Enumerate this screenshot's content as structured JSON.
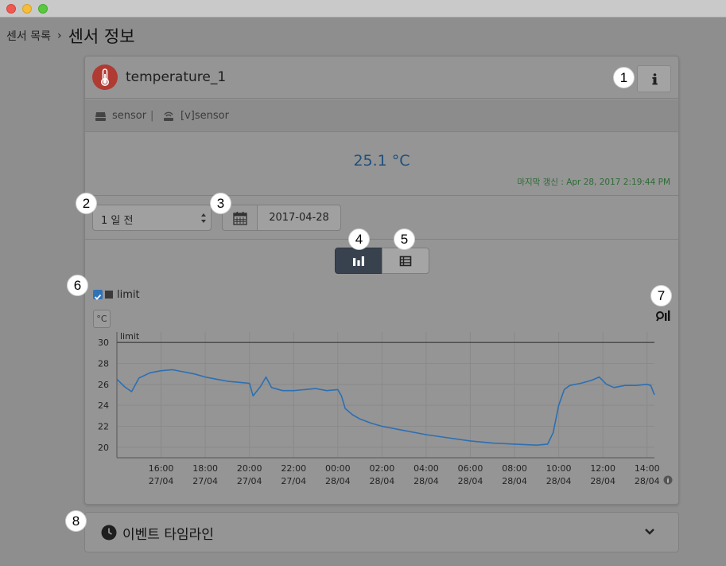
{
  "window": {
    "breadcrumb_parent": "센서 목록",
    "breadcrumb_separator": "›",
    "title": "센서 정보"
  },
  "sensor": {
    "name": "temperature_1",
    "icon": "thermometer-icon",
    "info_icon": "info-icon"
  },
  "meta": {
    "device": "sensor",
    "device_icon": "device-icon",
    "divider": "|",
    "virtual": "[v]sensor",
    "virtual_icon": "signal-icon"
  },
  "reading": {
    "value": "25.1 °C",
    "last_update": "마지막 갱신 : Apr 28, 2017 2:19:44 PM"
  },
  "controls": {
    "period": "1 일 전",
    "date": "2017-04-28",
    "calendar_icon": "calendar-icon",
    "chart_view_icon": "bar-chart-icon",
    "table_view_icon": "table-icon"
  },
  "legend": {
    "label": "limit",
    "checked": true
  },
  "unit": "°C",
  "zoom_icon": "zoom-icon",
  "annotations": [
    "1",
    "2",
    "3",
    "4",
    "5",
    "6",
    "7",
    "8"
  ],
  "timeline": {
    "label": "이벤트 타임라인",
    "icon": "clock-icon",
    "toggle_icon": "chevron-down-icon"
  },
  "colors": {
    "line": "#2d6fb3",
    "limit": "#3a3a3a",
    "value_text": "#1f4f7d",
    "updated_text": "#2d6b35",
    "sensor_icon_bg": "#b03b33"
  },
  "chart_data": {
    "type": "line",
    "ylabel": "°C",
    "ylim": [
      19,
      31
    ],
    "yticks": [
      20,
      22,
      24,
      26,
      28,
      30
    ],
    "xlim": [
      "2017-04-27 14:00",
      "2017-04-28 14:20"
    ],
    "xticks": [
      {
        "time": "2017-04-27 16:00",
        "line1": "16:00",
        "line2": "27/04"
      },
      {
        "time": "2017-04-27 18:00",
        "line1": "18:00",
        "line2": "27/04"
      },
      {
        "time": "2017-04-27 20:00",
        "line1": "20:00",
        "line2": "27/04"
      },
      {
        "time": "2017-04-27 22:00",
        "line1": "22:00",
        "line2": "27/04"
      },
      {
        "time": "2017-04-28 00:00",
        "line1": "00:00",
        "line2": "28/04"
      },
      {
        "time": "2017-04-28 02:00",
        "line1": "02:00",
        "line2": "28/04"
      },
      {
        "time": "2017-04-28 04:00",
        "line1": "04:00",
        "line2": "28/04"
      },
      {
        "time": "2017-04-28 06:00",
        "line1": "06:00",
        "line2": "28/04"
      },
      {
        "time": "2017-04-28 08:00",
        "line1": "08:00",
        "line2": "28/04"
      },
      {
        "time": "2017-04-28 10:00",
        "line1": "10:00",
        "line2": "28/04"
      },
      {
        "time": "2017-04-28 12:00",
        "line1": "12:00",
        "line2": "28/04"
      },
      {
        "time": "2017-04-28 14:00",
        "line1": "14:00",
        "line2": "28/04"
      }
    ],
    "limit": {
      "name": "limit",
      "value": 30
    },
    "series": [
      {
        "name": "limit",
        "points": [
          [
            "2017-04-27 14:00",
            26.5
          ],
          [
            "2017-04-27 14:20",
            25.8
          ],
          [
            "2017-04-27 14:40",
            25.3
          ],
          [
            "2017-04-27 15:00",
            26.6
          ],
          [
            "2017-04-27 15:30",
            27.1
          ],
          [
            "2017-04-27 16:00",
            27.3
          ],
          [
            "2017-04-27 16:30",
            27.4
          ],
          [
            "2017-04-27 17:00",
            27.2
          ],
          [
            "2017-04-27 17:30",
            27.0
          ],
          [
            "2017-04-27 18:00",
            26.7
          ],
          [
            "2017-04-27 18:30",
            26.5
          ],
          [
            "2017-04-27 19:00",
            26.3
          ],
          [
            "2017-04-27 19:30",
            26.2
          ],
          [
            "2017-04-27 20:00",
            26.1
          ],
          [
            "2017-04-27 20:10",
            24.9
          ],
          [
            "2017-04-27 20:30",
            25.8
          ],
          [
            "2017-04-27 20:45",
            26.7
          ],
          [
            "2017-04-27 21:00",
            25.7
          ],
          [
            "2017-04-27 21:30",
            25.4
          ],
          [
            "2017-04-27 22:00",
            25.4
          ],
          [
            "2017-04-27 22:30",
            25.5
          ],
          [
            "2017-04-27 23:00",
            25.6
          ],
          [
            "2017-04-27 23:30",
            25.4
          ],
          [
            "2017-04-28 00:00",
            25.5
          ],
          [
            "2017-04-28 00:10",
            24.9
          ],
          [
            "2017-04-28 00:20",
            23.7
          ],
          [
            "2017-04-28 00:40",
            23.1
          ],
          [
            "2017-04-28 01:00",
            22.7
          ],
          [
            "2017-04-28 01:30",
            22.3
          ],
          [
            "2017-04-28 02:00",
            22.0
          ],
          [
            "2017-04-28 03:00",
            21.6
          ],
          [
            "2017-04-28 04:00",
            21.2
          ],
          [
            "2017-04-28 05:00",
            20.9
          ],
          [
            "2017-04-28 06:00",
            20.6
          ],
          [
            "2017-04-28 07:00",
            20.4
          ],
          [
            "2017-04-28 08:00",
            20.3
          ],
          [
            "2017-04-28 09:00",
            20.2
          ],
          [
            "2017-04-28 09:30",
            20.3
          ],
          [
            "2017-04-28 09:45",
            21.4
          ],
          [
            "2017-04-28 10:00",
            24.0
          ],
          [
            "2017-04-28 10:15",
            25.5
          ],
          [
            "2017-04-28 10:30",
            25.9
          ],
          [
            "2017-04-28 11:00",
            26.1
          ],
          [
            "2017-04-28 11:30",
            26.4
          ],
          [
            "2017-04-28 11:50",
            26.7
          ],
          [
            "2017-04-28 12:10",
            26.0
          ],
          [
            "2017-04-28 12:30",
            25.7
          ],
          [
            "2017-04-28 13:00",
            25.9
          ],
          [
            "2017-04-28 13:30",
            25.9
          ],
          [
            "2017-04-28 14:00",
            26.0
          ],
          [
            "2017-04-28 14:10",
            25.9
          ],
          [
            "2017-04-28 14:20",
            25.0
          ]
        ]
      }
    ],
    "grid": true,
    "legend": "top-left"
  }
}
